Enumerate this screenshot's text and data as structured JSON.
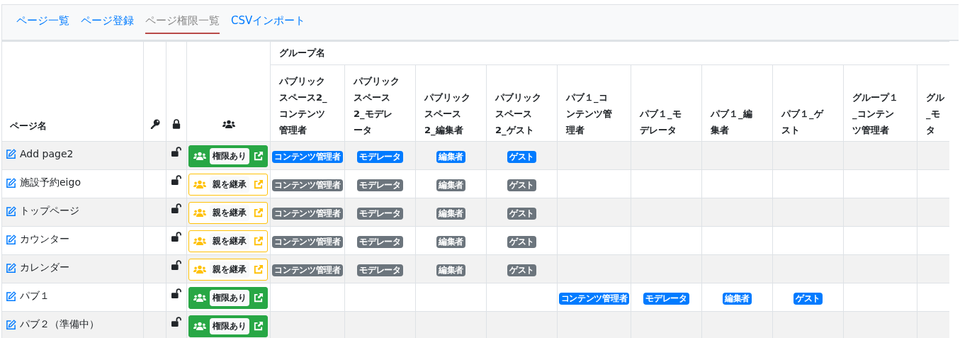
{
  "tabs": [
    {
      "label": "ページ一覧",
      "selected": false
    },
    {
      "label": "ページ登録",
      "selected": false
    },
    {
      "label": "ページ権限一覧",
      "selected": true
    },
    {
      "label": "CSVインポート",
      "selected": false
    }
  ],
  "table": {
    "page_column": "ページ名",
    "group_header": "グループ名",
    "group_columns": [
      [
        "パブリック",
        "スペース2_",
        "コンテンツ",
        "管理者"
      ],
      [
        "パブリック",
        "スペース",
        "2_モデレ",
        "ータ"
      ],
      [
        "パブリック",
        "スペース",
        "2_編集者"
      ],
      [
        "パブリック",
        "スペース",
        "2_ゲスト"
      ],
      [
        "パブ１_コ",
        "ンテンツ管",
        "理者"
      ],
      [
        "パブ１_モ",
        "デレータ"
      ],
      [
        "パブ１_編",
        "集者"
      ],
      [
        "パブ１_ゲ",
        "スト"
      ],
      [
        "グループ１",
        "_コンテン",
        "ツ管理者"
      ],
      [
        "グル",
        "_モ",
        "タ"
      ]
    ],
    "rows": [
      {
        "name": "Add page2",
        "locked": false,
        "permission": {
          "kind": "granted",
          "label": "権限あり"
        },
        "kind": "space2",
        "badges": [
          {
            "label": "コンテンツ管理者",
            "active": true
          },
          {
            "label": "モデレータ",
            "active": true
          },
          {
            "label": "編集者",
            "active": true
          },
          {
            "label": "ゲスト",
            "active": true
          }
        ]
      },
      {
        "name": "施設予約eigo",
        "locked": false,
        "permission": {
          "kind": "inherited",
          "label": "親を継承"
        },
        "kind": "space2",
        "badges": [
          {
            "label": "コンテンツ管理者",
            "active": false
          },
          {
            "label": "モデレータ",
            "active": false
          },
          {
            "label": "編集者",
            "active": false
          },
          {
            "label": "ゲスト",
            "active": false
          }
        ]
      },
      {
        "name": "トップページ",
        "locked": false,
        "permission": {
          "kind": "inherited",
          "label": "親を継承"
        },
        "kind": "space2",
        "badges": [
          {
            "label": "コンテンツ管理者",
            "active": false
          },
          {
            "label": "モデレータ",
            "active": false
          },
          {
            "label": "編集者",
            "active": false
          },
          {
            "label": "ゲスト",
            "active": false
          }
        ]
      },
      {
        "name": "カウンター",
        "locked": false,
        "permission": {
          "kind": "inherited",
          "label": "親を継承"
        },
        "kind": "space2",
        "badges": [
          {
            "label": "コンテンツ管理者",
            "active": false
          },
          {
            "label": "モデレータ",
            "active": false
          },
          {
            "label": "編集者",
            "active": false
          },
          {
            "label": "ゲスト",
            "active": false
          }
        ]
      },
      {
        "name": "カレンダー",
        "locked": false,
        "permission": {
          "kind": "inherited",
          "label": "親を継承"
        },
        "kind": "space2",
        "badges": [
          {
            "label": "コンテンツ管理者",
            "active": false
          },
          {
            "label": "モデレータ",
            "active": false
          },
          {
            "label": "編集者",
            "active": false
          },
          {
            "label": "ゲスト",
            "active": false
          }
        ]
      },
      {
        "name": "パブ１",
        "locked": false,
        "permission": {
          "kind": "granted",
          "label": "権限あり"
        },
        "kind": "pub1",
        "badges": [
          {
            "label": "コンテンツ管理者",
            "active": true
          },
          {
            "label": "モデレータ",
            "active": true
          },
          {
            "label": "編集者",
            "active": true
          },
          {
            "label": "ゲスト",
            "active": true
          }
        ]
      },
      {
        "name": "パブ２（準備中）",
        "locked": false,
        "permission": {
          "kind": "granted",
          "label": "権限あり"
        }
      }
    ]
  }
}
